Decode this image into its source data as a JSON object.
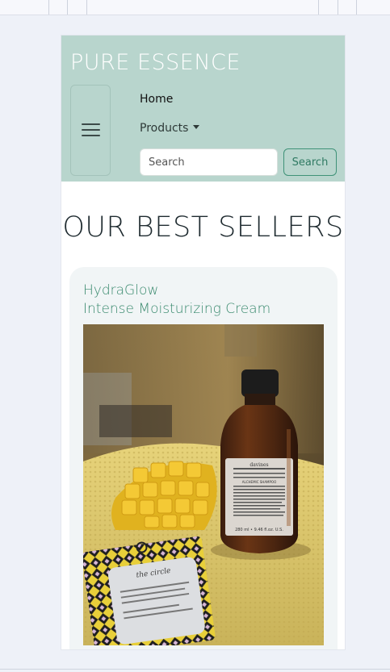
{
  "brand": {
    "name": "PURE ESSENCE"
  },
  "nav": {
    "items": [
      {
        "label": "Home"
      },
      {
        "label": "Products"
      }
    ],
    "search": {
      "placeholder": "Search",
      "button_label": "Search"
    }
  },
  "section": {
    "title": "OUR BEST SELLERS"
  },
  "product": {
    "title_line1": "HydraGlow",
    "title_line2": "Intense Moisturizing Cream",
    "bottle_brand": "davines",
    "bottle_text": "ALCHEMIC SHAMPOO",
    "bottle_volume": "280 ml • 9.46 fl.oz. U.S.",
    "pack_text": "the circle"
  },
  "colors": {
    "navbar": "#b8d5cd",
    "accent": "#3a8a6e",
    "card": "#f1f5f6"
  }
}
